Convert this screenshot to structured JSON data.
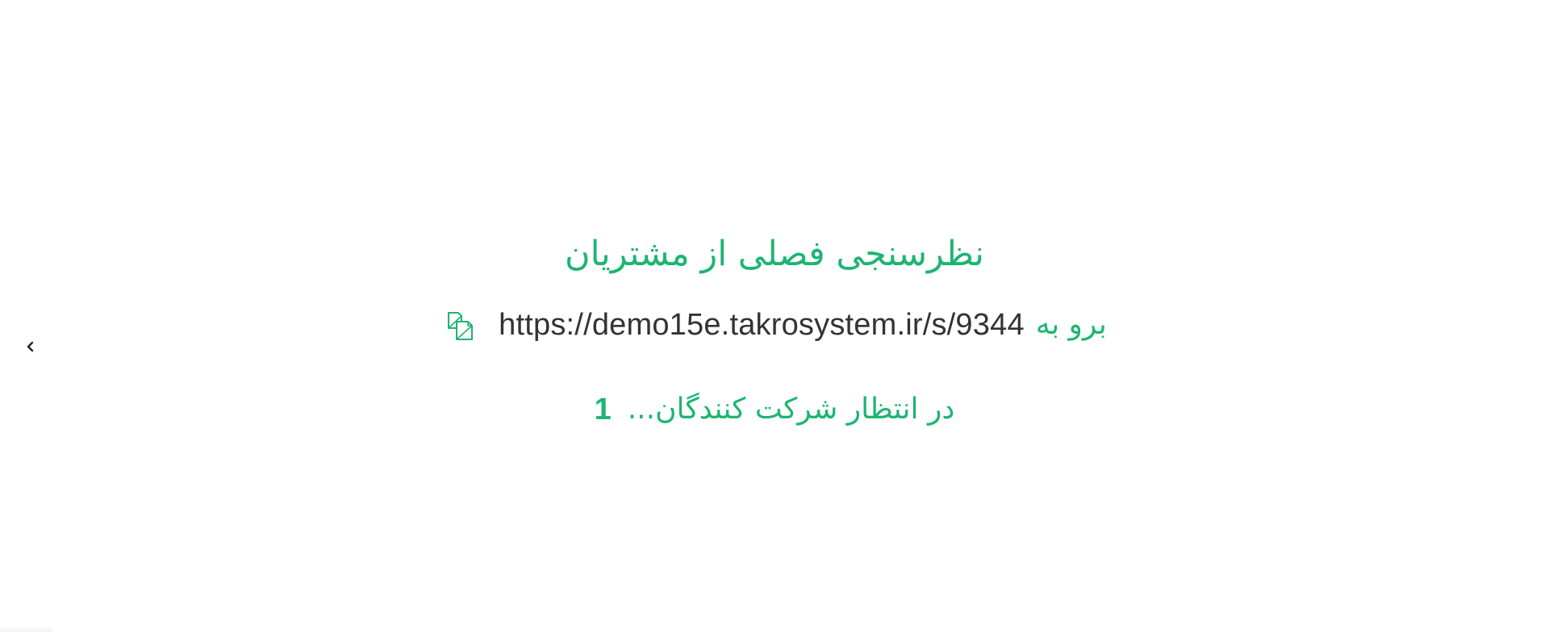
{
  "survey": {
    "title": "نظرسنجی فصلی از مشتریان",
    "goto_label": "برو به",
    "url": "https://demo15e.takrosystem.ir/s/9344",
    "waiting_text": "در انتظار شرکت کنندگان...",
    "participant_count": "1"
  },
  "icons": {
    "back": "chevron-left-icon",
    "copy": "copy-icon"
  },
  "colors": {
    "accent": "#1db572",
    "url_text": "#333333",
    "background": "#ffffff"
  }
}
